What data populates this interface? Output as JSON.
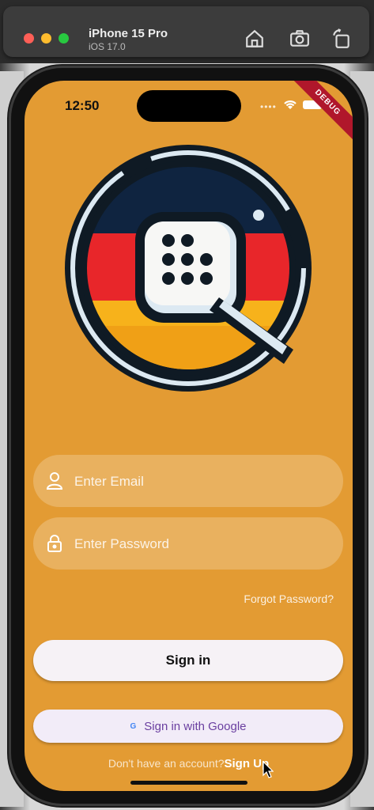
{
  "simulator": {
    "device_name": "iPhone 15 Pro",
    "os_version": "iOS 17.0",
    "icons": [
      "home-icon",
      "screenshot-icon",
      "rotate-icon"
    ]
  },
  "status_bar": {
    "time": "12:50",
    "debug_banner": "DEBUG"
  },
  "login": {
    "email_placeholder": "Enter Email",
    "password_placeholder": "Enter Password",
    "forgot_password": "Forgot Password?",
    "sign_in": "Sign in",
    "google_sign_in": "Sign in with Google",
    "google_glyph": "G",
    "no_account": "Don't have an account?",
    "sign_up": "Sign Up"
  },
  "colors": {
    "background": "#e39b33",
    "flag_black": "#0f2440",
    "flag_red": "#e8262a",
    "flag_gold": "#f7b21b",
    "google_text": "#6a3fa0"
  }
}
